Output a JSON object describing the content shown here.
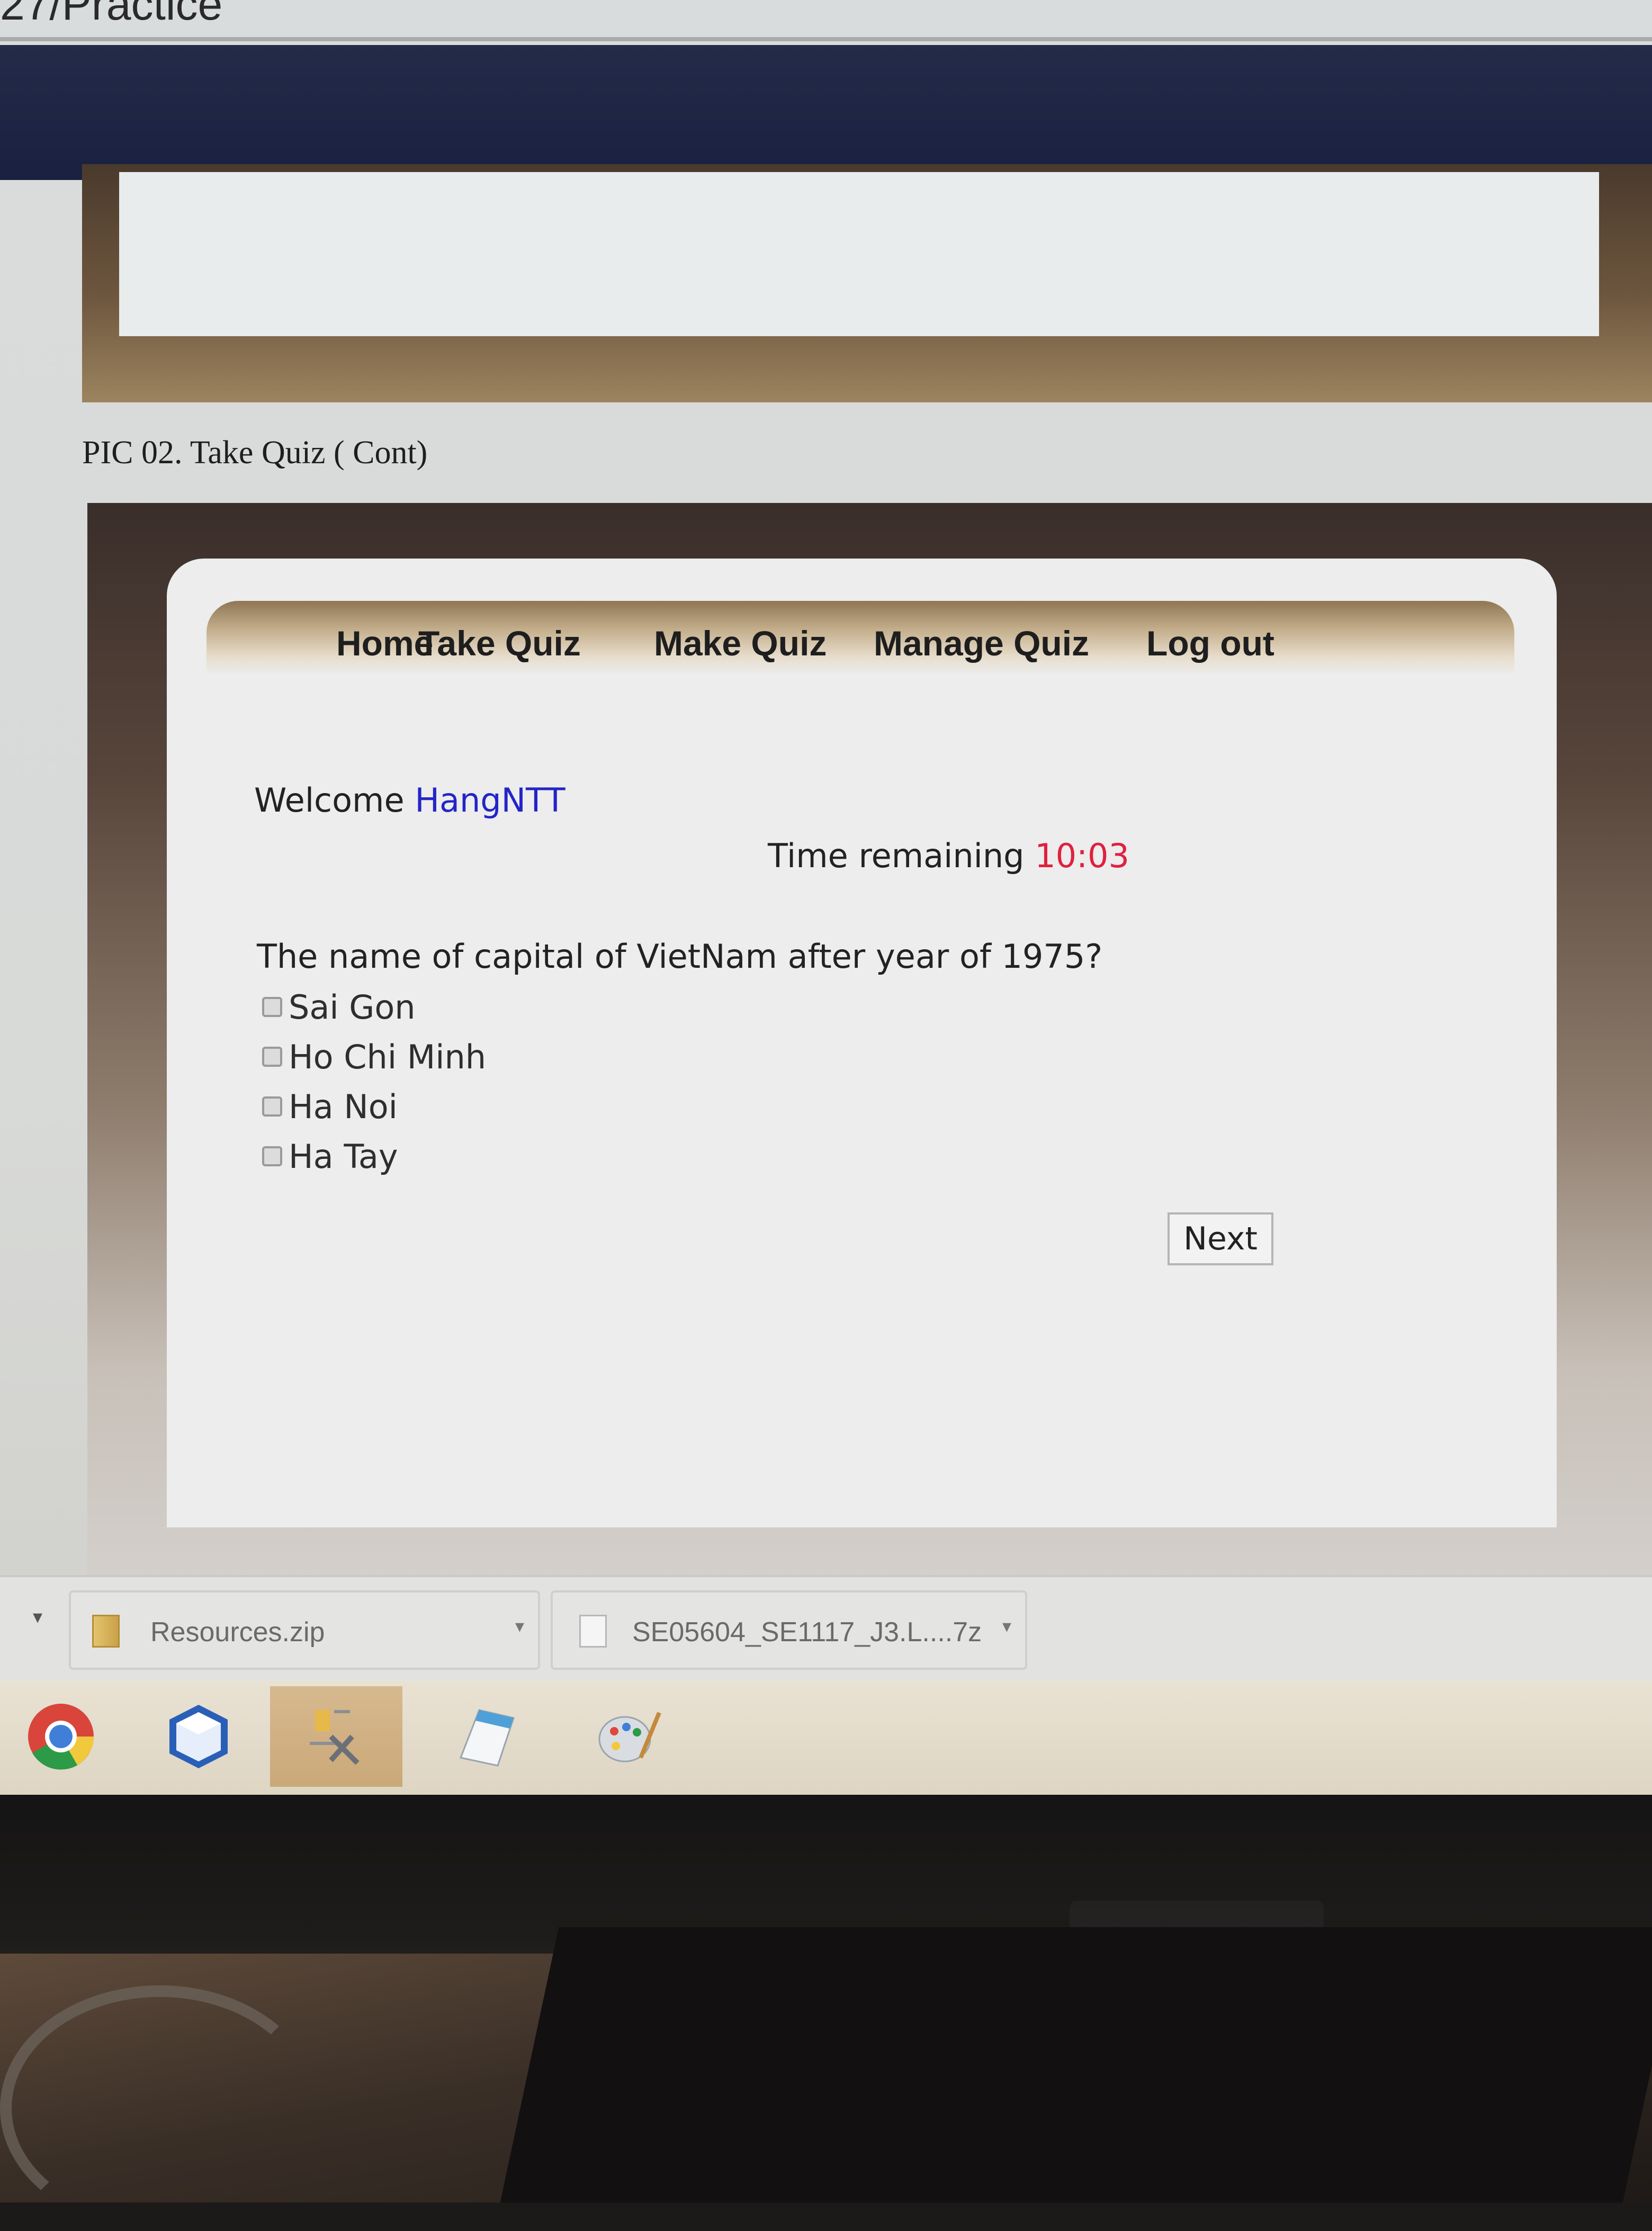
{
  "document": {
    "title_fragment": "27/Practice",
    "section_caption": "PIC 02. Take Quiz ( Cont)"
  },
  "nav": {
    "items": [
      {
        "label": "Home"
      },
      {
        "label": "Take Quiz"
      },
      {
        "label": "Make Quiz"
      },
      {
        "label": "Manage Quiz"
      },
      {
        "label": "Log out"
      }
    ]
  },
  "welcome": {
    "prefix": "Welcome",
    "username": "HangNTT"
  },
  "timer": {
    "label": "Time remaining",
    "value": "10:03"
  },
  "quiz": {
    "question": "The name of capital of VietNam after year of 1975?",
    "options": [
      {
        "label": "Sai Gon",
        "checked": false
      },
      {
        "label": "Ho Chi Minh",
        "checked": false
      },
      {
        "label": "Ha Noi",
        "checked": false
      },
      {
        "label": "Ha Tay",
        "checked": false
      }
    ],
    "next_label": "Next"
  },
  "downloads": [
    {
      "name": "Resources.zip",
      "icon": "zip-file-icon"
    },
    {
      "name": "SE05604_SE1117_J3.L....7z",
      "icon": "file-icon"
    }
  ],
  "taskbar": {
    "apps": [
      {
        "icon": "chrome-icon"
      },
      {
        "icon": "cube-app-icon"
      },
      {
        "icon": "tools-app-icon"
      },
      {
        "icon": "notepad-icon"
      },
      {
        "icon": "paint-icon"
      }
    ]
  },
  "colors": {
    "username": "#2424c8",
    "timer_value": "#e02040",
    "header_band": "#1a2140"
  }
}
